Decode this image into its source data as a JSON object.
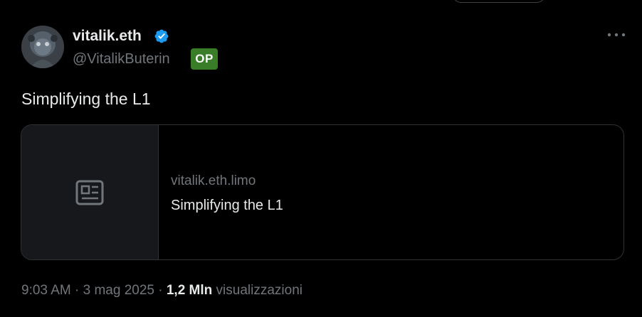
{
  "author": {
    "name": "vitalik.eth",
    "handle": "@VitalikButerin",
    "badge": "OP",
    "verified_color": "#1d9bf0",
    "avatar_icon": "avatar-image"
  },
  "tweet": {
    "text": "Simplifying the L1"
  },
  "link_card": {
    "thumbnail_icon": "article-icon",
    "domain": "vitalik.eth.limo",
    "title": "Simplifying the L1"
  },
  "meta": {
    "time": "9:03 AM",
    "separator1": " · ",
    "date": "3 mag 2025",
    "separator2": " · ",
    "views_count": "1,2 Mln",
    "views_label": " visualizzazioni"
  },
  "colors": {
    "background": "#000000",
    "text": "#e7e9ea",
    "muted": "#71767b",
    "border": "#2f3336",
    "op_badge": "#3a7d28",
    "verified": "#1d9bf0"
  }
}
